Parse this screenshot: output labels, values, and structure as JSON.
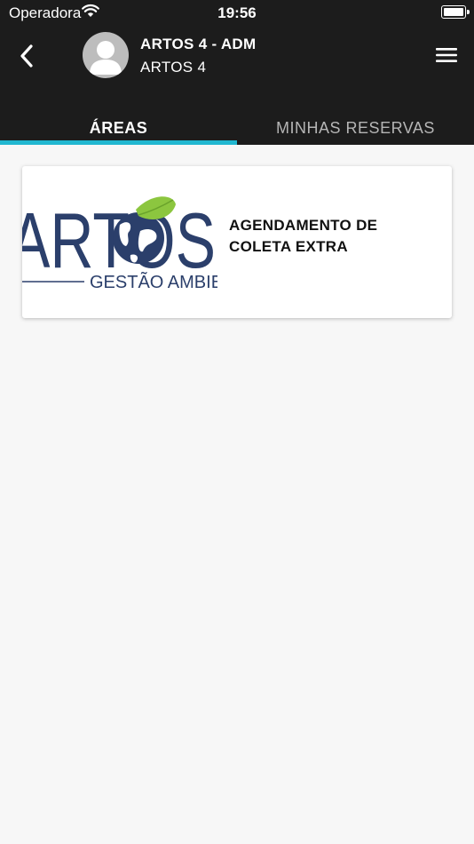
{
  "status_bar": {
    "carrier": "Operadora",
    "time": "19:56"
  },
  "header": {
    "title": "ARTOS 4 - ADM",
    "subtitle": "ARTOS 4"
  },
  "tabs": [
    {
      "label": "ÁREAS",
      "active": true
    },
    {
      "label": "MINHAS RESERVAS",
      "active": false
    }
  ],
  "areas": [
    {
      "label_line1": "AGENDAMENTO DE",
      "label_line2": "COLETA EXTRA",
      "logo_text": "ARTOS",
      "logo_tagline": "GESTÃO AMBIE"
    }
  ],
  "colors": {
    "header_bg": "#1c1c1c",
    "accent": "#21b7d0",
    "logo_blue": "#2b3f6b",
    "logo_leaf": "#8cc63f"
  }
}
